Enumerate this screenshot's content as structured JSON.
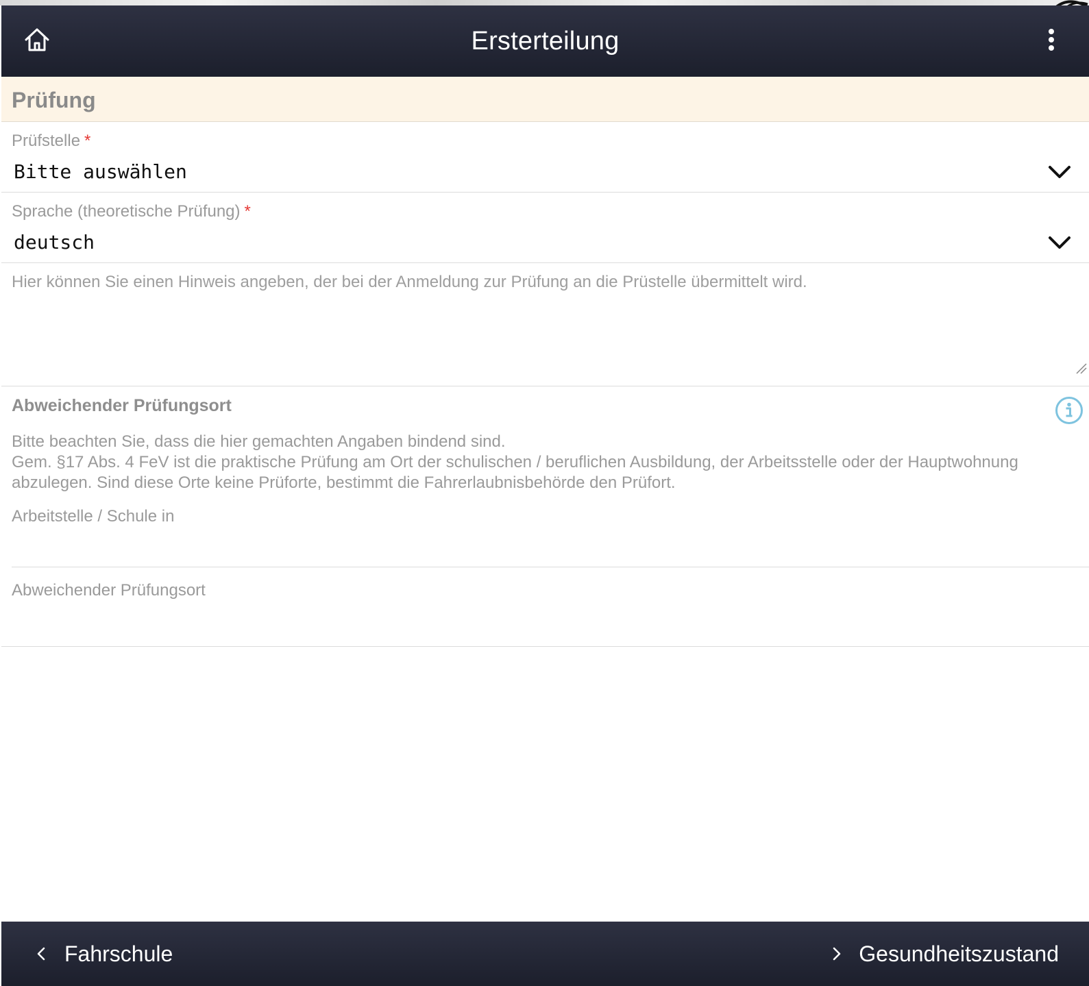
{
  "header": {
    "title": "Ersterteilung",
    "home_icon": "home-icon",
    "menu_icon": "more-vertical-icon"
  },
  "section": {
    "title": "Prüfung"
  },
  "fields": {
    "pruefstelle": {
      "label": "Prüfstelle",
      "required_mark": "*",
      "value": "Bitte auswählen"
    },
    "sprache": {
      "label": "Sprache (theoretische Prüfung)",
      "required_mark": "*",
      "value": "deutsch"
    },
    "hinweis": {
      "placeholder": "Hier können Sie einen Hinweis angeben, der bei der Anmeldung zur Prüfung an die Prüstelle übermittelt wird."
    }
  },
  "alt_location": {
    "title": "Abweichender Prüfungsort",
    "info_icon": "info-icon",
    "desc_line1": "Bitte beachten Sie, dass die hier gemachten Angaben bindend sind.",
    "desc_line2": "Gem. §17 Abs. 4 FeV ist die praktische Prüfung am Ort der schulischen / beruflichen Ausbildung, der Arbeitsstelle oder der Hauptwohnung abzulegen. Sind diese Orte keine Prüforte, bestimmt die Fahrerlaubnisbehörde den Prüfort.",
    "workplace_label": "Arbeitstelle / Schule in",
    "alt_place_label": "Abweichender Prüfungsort"
  },
  "footer": {
    "back_label": "Fahrschule",
    "next_label": "Gesundheitszustand"
  },
  "colors": {
    "header_bg": "#24273a",
    "section_bg": "#fdf4e6",
    "required": "#e53935",
    "info_accent": "#7ec3df"
  }
}
